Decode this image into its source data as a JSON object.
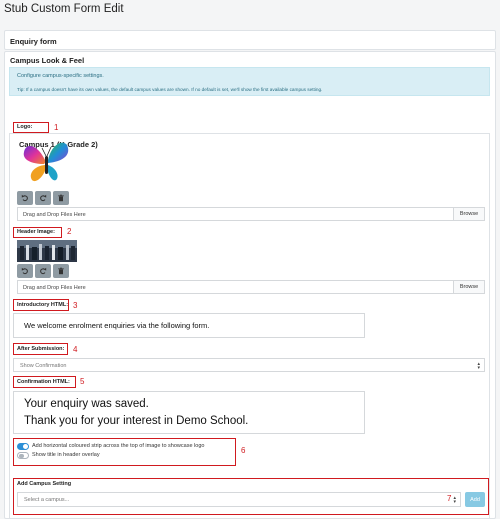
{
  "page_title": "Stub Custom Form Edit",
  "form_card": {
    "title": "Enquiry form"
  },
  "look_card": {
    "title": "Campus Look & Feel",
    "info_line1": "Configure campus-specific settings.",
    "info_line2": "Tip: If a campus doesn't have its own values, the default campus values are shown. If no default is set, we'll show the first available campus setting."
  },
  "campus": {
    "title": "Campus 1 (K-Grade 2)",
    "logo_label": "Logo:",
    "header_image_label": "Header Image:",
    "intro_label": "Introductory HTML:",
    "intro_text": "We welcome enrolment enquiries via the following form.",
    "after_submission_label": "After Submission:",
    "after_submission_value": "Show Confirmation",
    "confirmation_label": "Confirmation HTML:",
    "confirmation_line1": "Your enquiry was saved.",
    "confirmation_line2": "Thank you for your interest in Demo School.",
    "toggle_strip_label": "Add horizontal coloured strip across the top of image to showcase logo",
    "toggle_strip_on": true,
    "toggle_title_label": "Show title in header overlay",
    "toggle_title_on": false
  },
  "dropzone": {
    "text": "Drag and Drop Files Here",
    "browse_label": "Browse"
  },
  "add_campus": {
    "label": "Add Campus Setting",
    "placeholder": "Select a campus...",
    "add_label": "Add"
  },
  "annotations": [
    "1",
    "2",
    "3",
    "4",
    "5",
    "6",
    "7"
  ],
  "colors": {
    "toggle_on": "#2b8fd6",
    "toggle_off": "#adb5bd",
    "annotation": "#d01a1f",
    "icon_button": "#8f9ba3"
  },
  "icons": [
    "undo-icon",
    "redo-icon",
    "trash-icon",
    "butterfly-logo",
    "header-image-thumbnail"
  ]
}
